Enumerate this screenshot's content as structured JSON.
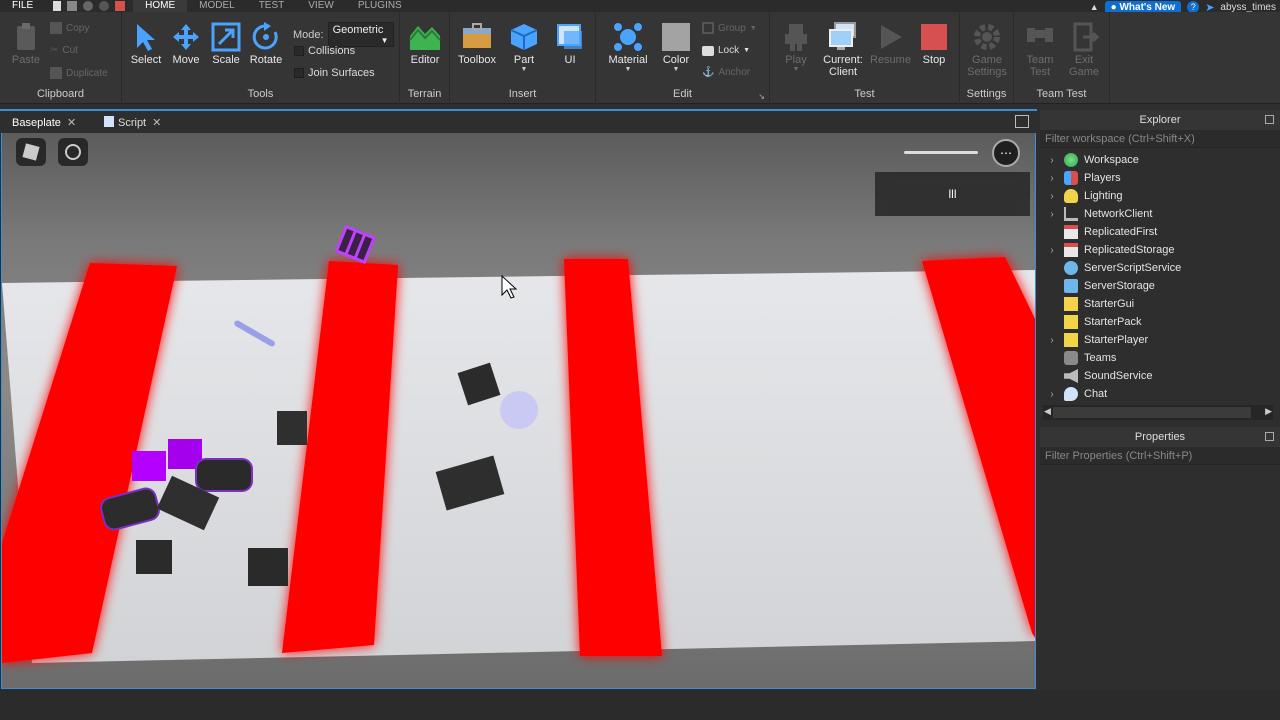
{
  "menubar": {
    "file": "FILE",
    "tabs": [
      "HOME",
      "MODEL",
      "TEST",
      "VIEW",
      "PLUGINS"
    ],
    "active_tab": "HOME",
    "whats_new": "What's New",
    "username": "abyss_times"
  },
  "ribbon": {
    "clipboard": {
      "title": "Clipboard",
      "paste": "Paste",
      "copy": "Copy",
      "cut": "Cut",
      "duplicate": "Duplicate"
    },
    "tools": {
      "title": "Tools",
      "select": "Select",
      "move": "Move",
      "scale": "Scale",
      "rotate": "Rotate",
      "mode_label": "Mode:",
      "mode_value": "Geometric",
      "collisions": "Collisions",
      "join_surfaces": "Join Surfaces"
    },
    "terrain": {
      "title": "Terrain",
      "editor": "Editor"
    },
    "insert": {
      "title": "Insert",
      "toolbox": "Toolbox",
      "part": "Part",
      "ui": "UI"
    },
    "edit": {
      "title": "Edit",
      "material": "Material",
      "color": "Color",
      "group": "Group",
      "lock": "Lock",
      "anchor": "Anchor"
    },
    "test": {
      "title": "Test",
      "play": "Play",
      "current_1": "Current:",
      "current_2": "Client",
      "resume": "Resume",
      "stop": "Stop"
    },
    "settings": {
      "title": "Settings",
      "game_settings_1": "Game",
      "game_settings_2": "Settings"
    },
    "team_test": {
      "title": "Team Test",
      "team_test_1": "Team",
      "team_test_2": "Test",
      "exit_game_1": "Exit",
      "exit_game_2": "Game"
    }
  },
  "doctabs": [
    {
      "label": "Baseplate"
    },
    {
      "label": "Script"
    }
  ],
  "viewport": {
    "perf_text": "lll"
  },
  "explorer": {
    "title": "Explorer",
    "filter_placeholder": "Filter workspace (Ctrl+Shift+X)",
    "items": [
      {
        "label": "Workspace",
        "icon": "globe-icon",
        "expandable": true
      },
      {
        "label": "Players",
        "icon": "players-icon",
        "expandable": true
      },
      {
        "label": "Lighting",
        "icon": "lightbulb-icon",
        "expandable": true
      },
      {
        "label": "NetworkClient",
        "icon": "network-icon",
        "expandable": true
      },
      {
        "label": "ReplicatedFirst",
        "icon": "replicated-first-icon",
        "expandable": false
      },
      {
        "label": "ReplicatedStorage",
        "icon": "replicated-storage-icon",
        "expandable": true
      },
      {
        "label": "ServerScriptService",
        "icon": "server-script-icon",
        "expandable": false
      },
      {
        "label": "ServerStorage",
        "icon": "server-storage-icon",
        "expandable": false
      },
      {
        "label": "StarterGui",
        "icon": "folder-icon",
        "expandable": false
      },
      {
        "label": "StarterPack",
        "icon": "folder-icon",
        "expandable": false
      },
      {
        "label": "StarterPlayer",
        "icon": "folder-icon",
        "expandable": true
      },
      {
        "label": "Teams",
        "icon": "teams-icon",
        "expandable": false
      },
      {
        "label": "SoundService",
        "icon": "sound-icon",
        "expandable": false
      },
      {
        "label": "Chat",
        "icon": "chat-icon",
        "expandable": true
      }
    ]
  },
  "properties": {
    "title": "Properties",
    "filter_placeholder": "Filter Properties (Ctrl+Shift+P)"
  },
  "colors": {
    "accent": "#3a8fd9",
    "brand": "#0f6ed0",
    "hazard": "#ff0000",
    "neon": "#b400ff"
  }
}
